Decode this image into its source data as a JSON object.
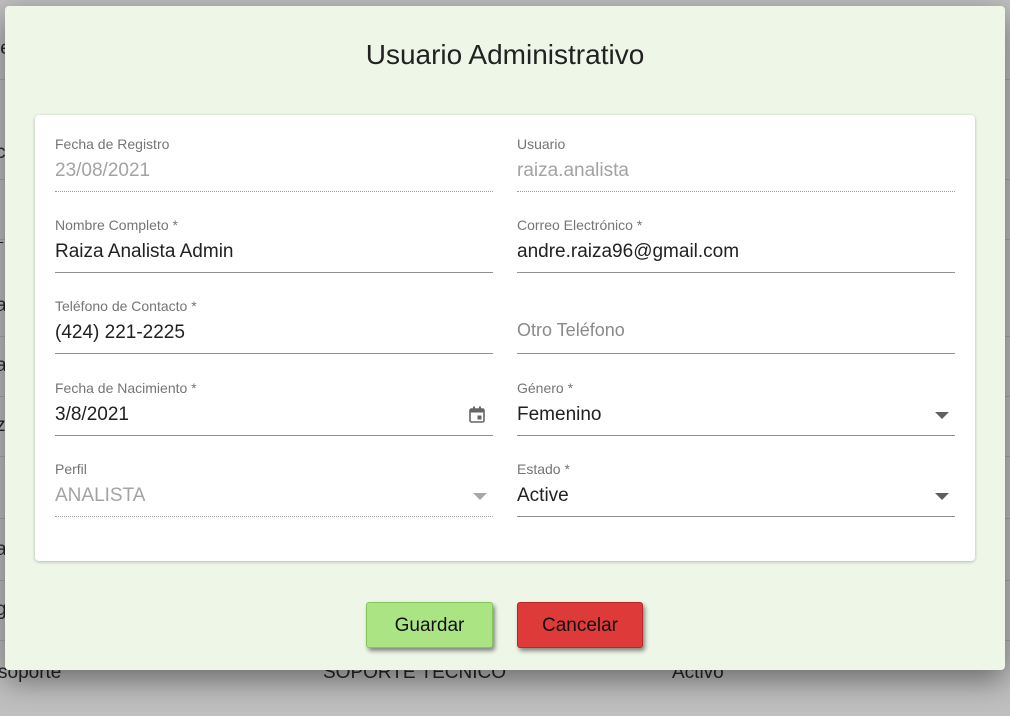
{
  "background": {
    "row_fragments": [
      "le",
      "c",
      "L",
      "a",
      "a",
      "z",
      "i",
      "a",
      "g"
    ],
    "last_row": {
      "col1": "soporte",
      "col2": "SOPORTE TECNICO",
      "col3": "Activo"
    }
  },
  "dialog": {
    "title": "Usuario Administrativo",
    "fields": {
      "fecha_registro": {
        "label": "Fecha de Registro",
        "value": "23/08/2021"
      },
      "usuario": {
        "label": "Usuario",
        "value": "raiza.analista"
      },
      "nombre": {
        "label": "Nombre Completo *",
        "value": "Raiza Analista Admin"
      },
      "correo": {
        "label": "Correo Electrónico *",
        "value": "andre.raiza96@gmail.com"
      },
      "telefono": {
        "label": "Teléfono de Contacto *",
        "value": "(424) 221-2225"
      },
      "otro_telefono": {
        "placeholder": "Otro Teléfono"
      },
      "fecha_nacimiento": {
        "label": "Fecha de Nacimiento *",
        "value": "3/8/2021"
      },
      "genero": {
        "label": "Género *",
        "value": "Femenino"
      },
      "perfil": {
        "label": "Perfil",
        "value": "ANALISTA"
      },
      "estado": {
        "label": "Estado *",
        "value": "Active"
      }
    },
    "buttons": {
      "save": "Guardar",
      "cancel": "Cancelar"
    },
    "icons": {
      "date": "calendar-icon",
      "select": "caret-down-icon"
    },
    "colors": {
      "dialog_bg": "#eef6e8",
      "save_bg": "#abe583",
      "cancel_bg": "#de3a3a"
    }
  }
}
